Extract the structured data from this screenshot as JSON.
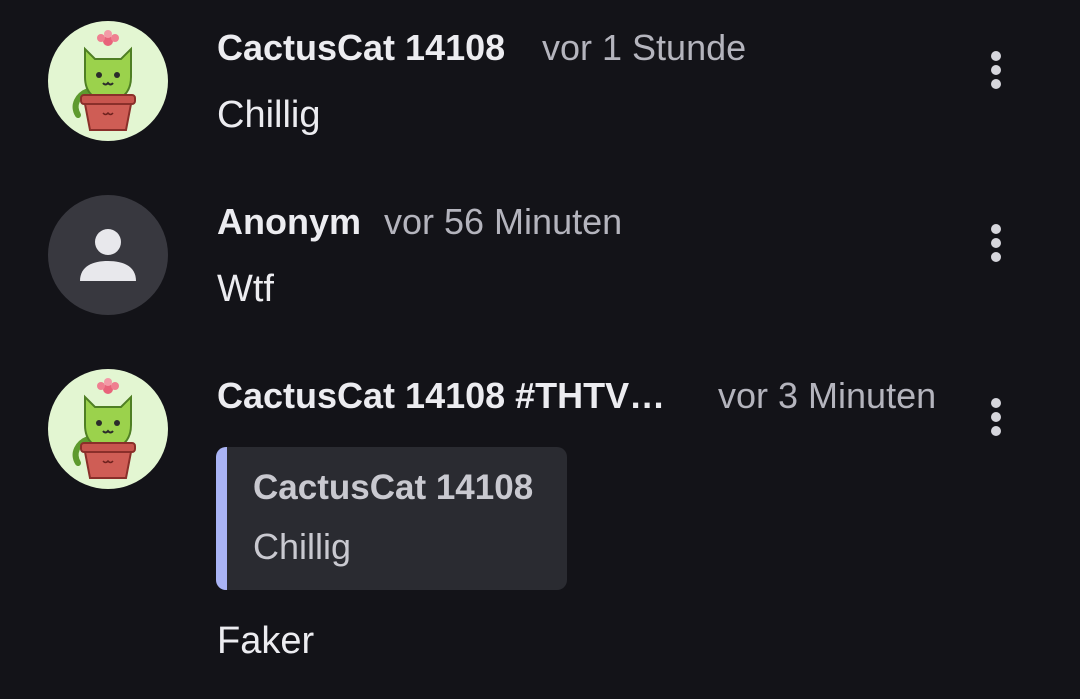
{
  "comments": [
    {
      "author": "CactusCat 14108",
      "time": "vor 1 Stunde",
      "text": "Chillig",
      "avatar": "cactus-cat-avatar-icon",
      "menu_icon": "more-vertical-icon"
    },
    {
      "author": "Anonym",
      "time": "vor 56 Minuten",
      "text": "Wtf",
      "avatar": "anonymous-user-icon",
      "menu_icon": "more-vertical-icon"
    },
    {
      "author": "CactusCat 14108 #THTV…",
      "time": "vor 3 Minuten",
      "text": "Faker",
      "avatar": "cactus-cat-avatar-icon",
      "menu_icon": "more-vertical-icon",
      "quote": {
        "author": "CactusCat 14108",
        "text": "Chillig"
      }
    }
  ],
  "colors": {
    "background": "#131318",
    "quote_accent": "#aab4f5",
    "quote_background": "#2a2b31",
    "cactus_avatar_background": "#e3f6d2",
    "anonymous_avatar_background": "#38383f"
  }
}
